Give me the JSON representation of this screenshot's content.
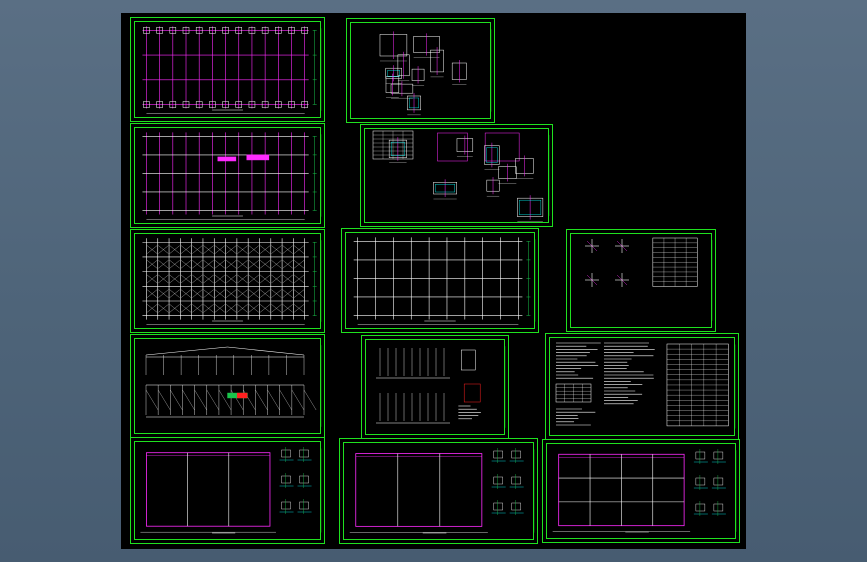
{
  "viewport": {
    "background": "#4e6479",
    "canvas_background": "#000000"
  },
  "palette": {
    "frame": "#1fe11f",
    "grid": "#ff2bff",
    "line": "#ffffff",
    "accent": "#00ffff",
    "highlight": "#19c44b",
    "warn": "#ff2020"
  },
  "sheets": [
    {
      "id": "foundation-plan",
      "kind": "plan-foundation",
      "caption": ""
    },
    {
      "id": "column-details",
      "kind": "details-small",
      "caption": ""
    },
    {
      "id": "anchor-bolt-plan",
      "kind": "plan-axis",
      "caption": ""
    },
    {
      "id": "connection-details",
      "kind": "details-table",
      "caption": ""
    },
    {
      "id": "roof-bracing-plan",
      "kind": "plan-dense",
      "caption": ""
    },
    {
      "id": "roof-purlin-plan",
      "kind": "plan-grid",
      "caption": ""
    },
    {
      "id": "node-details",
      "kind": "details-table-small",
      "caption": ""
    },
    {
      "id": "elevations",
      "kind": "elevation",
      "caption": ""
    },
    {
      "id": "frame-sections",
      "kind": "sections",
      "caption": ""
    },
    {
      "id": "design-notes",
      "kind": "notes",
      "caption": ""
    },
    {
      "id": "building-plan-1",
      "kind": "building-plan",
      "caption": ""
    },
    {
      "id": "building-plan-2",
      "kind": "building-plan",
      "caption": ""
    },
    {
      "id": "building-plan-3",
      "kind": "building-plan-grid",
      "caption": ""
    }
  ]
}
